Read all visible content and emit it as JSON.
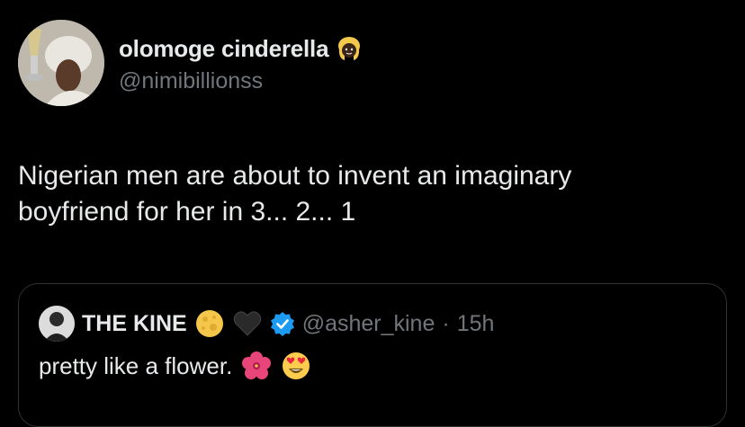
{
  "author": {
    "display_name": "olomoge cinderella",
    "handle": "@nimibillionss",
    "badge_emoji": "blonde-person-emoji"
  },
  "tweet": {
    "text_line1": "Nigerian men are about to invent an imaginary",
    "text_line2": "boyfriend for her in 3... 2... 1"
  },
  "quote": {
    "display_name": "THE KINE",
    "name_emojis": [
      "full-moon-emoji",
      "black-heart-emoji"
    ],
    "verified": true,
    "handle": "@asher_kine",
    "separator": "·",
    "time": "15h",
    "text": "pretty like a flower.",
    "text_emojis": [
      "hibiscus-emoji",
      "heart-eyes-emoji"
    ]
  },
  "colors": {
    "background": "#000000",
    "primary_text": "#e7e9ea",
    "secondary_text": "#71767b",
    "border": "#2f3336",
    "verified_blue": "#1d9bf0"
  }
}
